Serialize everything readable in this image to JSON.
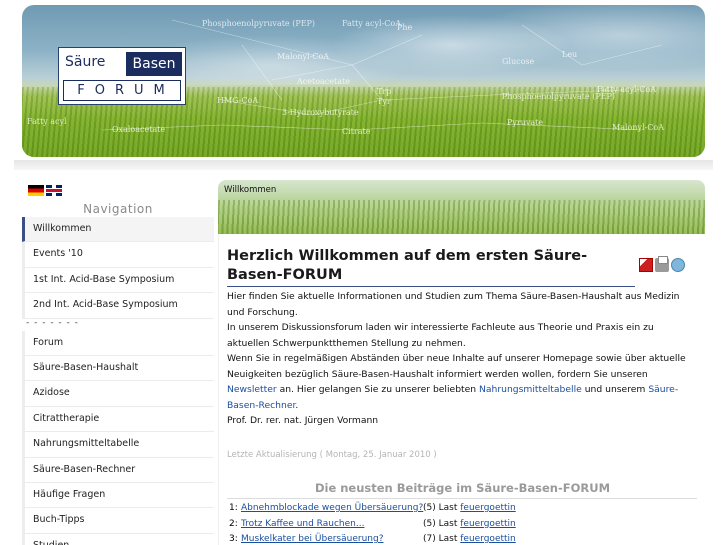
{
  "header": {
    "logo_word1": "Säure",
    "logo_word2": "Basen",
    "logo_word3": "FORUM",
    "chem_labels": [
      "Phosphoenolpyruvate (PEP)",
      "Fatty acyl-CoA",
      "Malonyl-CoA",
      "Acetoacetate",
      "Trp",
      "Tyr",
      "HMG-CoA",
      "3-Hydroxybutyrate",
      "Phosphoenolpyruvate (PEP)",
      "Fatty acyl-CoA",
      "Phe",
      "Leu",
      "Glucose",
      "Pyruvate",
      "Malonyl-CoA",
      "Fatty acyl",
      "Oxaloacetate",
      "Citrate"
    ]
  },
  "sidebar": {
    "flags": [
      "de-flag-icon",
      "uk-flag-icon"
    ],
    "nav_title": "Navigation",
    "items_top": [
      {
        "label": "Willkommen",
        "active": true
      },
      {
        "label": "Events '10"
      },
      {
        "label": "1st Int. Acid-Base Symposium"
      },
      {
        "label": "2nd Int. Acid-Base Symposium"
      }
    ],
    "separator": "- - - - - - -",
    "items_bottom": [
      {
        "label": "Forum"
      },
      {
        "label": "Säure-Basen-Haushalt"
      },
      {
        "label": "Azidose"
      },
      {
        "label": "Citrattherapie"
      },
      {
        "label": "Nahrungsmitteltabelle"
      },
      {
        "label": "Säure-Basen-Rechner"
      },
      {
        "label": "Häufige Fragen"
      },
      {
        "label": "Buch-Tipps"
      },
      {
        "label": "Studien"
      }
    ]
  },
  "content": {
    "breadcrumb": "Willkommen",
    "title": "Herzlich Willkommen auf dem ersten Säure-Basen-FORUM",
    "para1": "Hier finden Sie aktuelle Informationen und Studien zum Thema Säure-Basen-Haushalt aus Medizin und Forschung.",
    "para2": "In unserem Diskussionsforum laden wir interessierte Fachleute aus Theorie und Praxis ein zu aktuellen Schwerpunktthemen Stellung zu nehmen.",
    "para3_a": "Wenn Sie in regelmäßigen Abständen über neue Inhalte auf unserer Homepage sowie über aktuelle Neuigkeiten bezüglich Säure-Basen-Haushalt informiert werden wollen, fordern Sie unseren ",
    "para3_link1": "Newsletter",
    "para3_b": " an. Hier gelangen Sie zu unserer beliebten ",
    "para3_link2": "Nahrungsmitteltabelle",
    "para3_c": " und unserem ",
    "para3_link3": "Säure-Basen-Rechner",
    "para3_d": ".",
    "signature": "Prof. Dr. rer. nat. Jürgen Vormann",
    "updated": "Letzte Aktualisierung ( Montag, 25. Januar 2010 )",
    "forum_heading": "Die neusten Beiträge im Säure-Basen-FORUM",
    "posts": [
      {
        "num": "1:",
        "topic": "Abnehmblockade wegen Übersäuerung?",
        "count": "(5) Last",
        "user": "feuergoettin"
      },
      {
        "num": "2:",
        "topic": "Trotz Kaffee und Rauchen...",
        "count": "(5) Last",
        "user": "feuergoettin"
      },
      {
        "num": "3:",
        "topic": "Muskelkater bei Übersäuerung?",
        "count": "(7) Last",
        "user": "feuergoettin"
      }
    ]
  }
}
